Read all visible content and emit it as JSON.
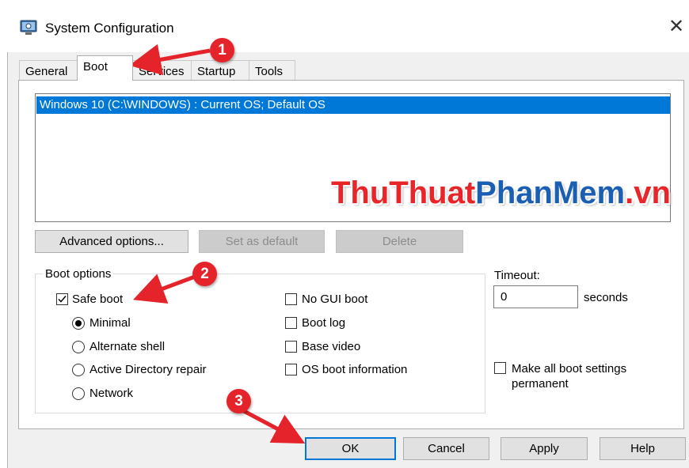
{
  "window": {
    "title": "System Configuration",
    "close_glyph": "✕"
  },
  "tabs": [
    {
      "label": "General"
    },
    {
      "label": "Boot"
    },
    {
      "label": "Services"
    },
    {
      "label": "Startup"
    },
    {
      "label": "Tools"
    }
  ],
  "os_list": {
    "items": [
      "Windows 10 (C:\\WINDOWS) : Current OS; Default OS"
    ]
  },
  "watermark": {
    "part1": "ThuThuat",
    "part2": "PhanMem",
    "part3": ".vn"
  },
  "buttons": {
    "advanced": "Advanced options...",
    "set_default": "Set as default",
    "delete": "Delete",
    "ok": "OK",
    "cancel": "Cancel",
    "apply": "Apply",
    "help": "Help"
  },
  "boot_options": {
    "group_label": "Boot options",
    "safe_boot": "Safe boot",
    "minimal": "Minimal",
    "alternate_shell": "Alternate shell",
    "ad_repair": "Active Directory repair",
    "network": "Network",
    "no_gui": "No GUI boot",
    "boot_log": "Boot log",
    "base_video": "Base video",
    "os_info": "OS boot information"
  },
  "timeout": {
    "label": "Timeout:",
    "value": "0",
    "unit": "seconds"
  },
  "permanent": {
    "label": "Make all boot settings permanent"
  },
  "annotations": {
    "step1": "1",
    "step2": "2",
    "step3": "3"
  },
  "colors": {
    "selection": "#0078d7",
    "badge": "#e5232b",
    "watermark_red": "#e8262a",
    "watermark_blue": "#1b5fb3"
  },
  "icons": {
    "app": "system-config-icon",
    "close": "close-icon"
  }
}
